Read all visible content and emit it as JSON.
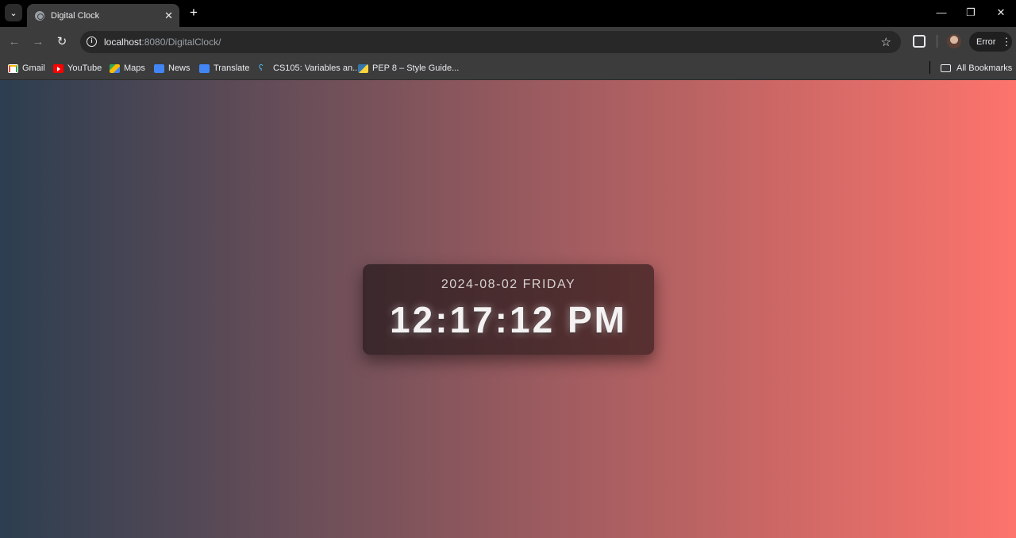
{
  "browser": {
    "tab_title": "Digital Clock",
    "url_host": "localhost",
    "url_rest": ":8080/DigitalClock/",
    "profile_button_label": "Error",
    "bookmarks": [
      {
        "label": "Gmail",
        "icon": "gmail-icon"
      },
      {
        "label": "YouTube",
        "icon": "youtube-icon"
      },
      {
        "label": "Maps",
        "icon": "maps-icon"
      },
      {
        "label": "News",
        "icon": "news-icon"
      },
      {
        "label": "Translate",
        "icon": "translate-icon"
      },
      {
        "label": "CS105: Variables an...",
        "icon": "cs-icon"
      },
      {
        "label": "PEP 8 – Style Guide...",
        "icon": "python-icon"
      }
    ],
    "all_bookmarks_label": "All Bookmarks"
  },
  "clock": {
    "date": "2024-08-02 FRIDAY",
    "time": "12:17:12 PM",
    "gradient_start": "#2c3e50",
    "gradient_end": "#fd746c"
  }
}
